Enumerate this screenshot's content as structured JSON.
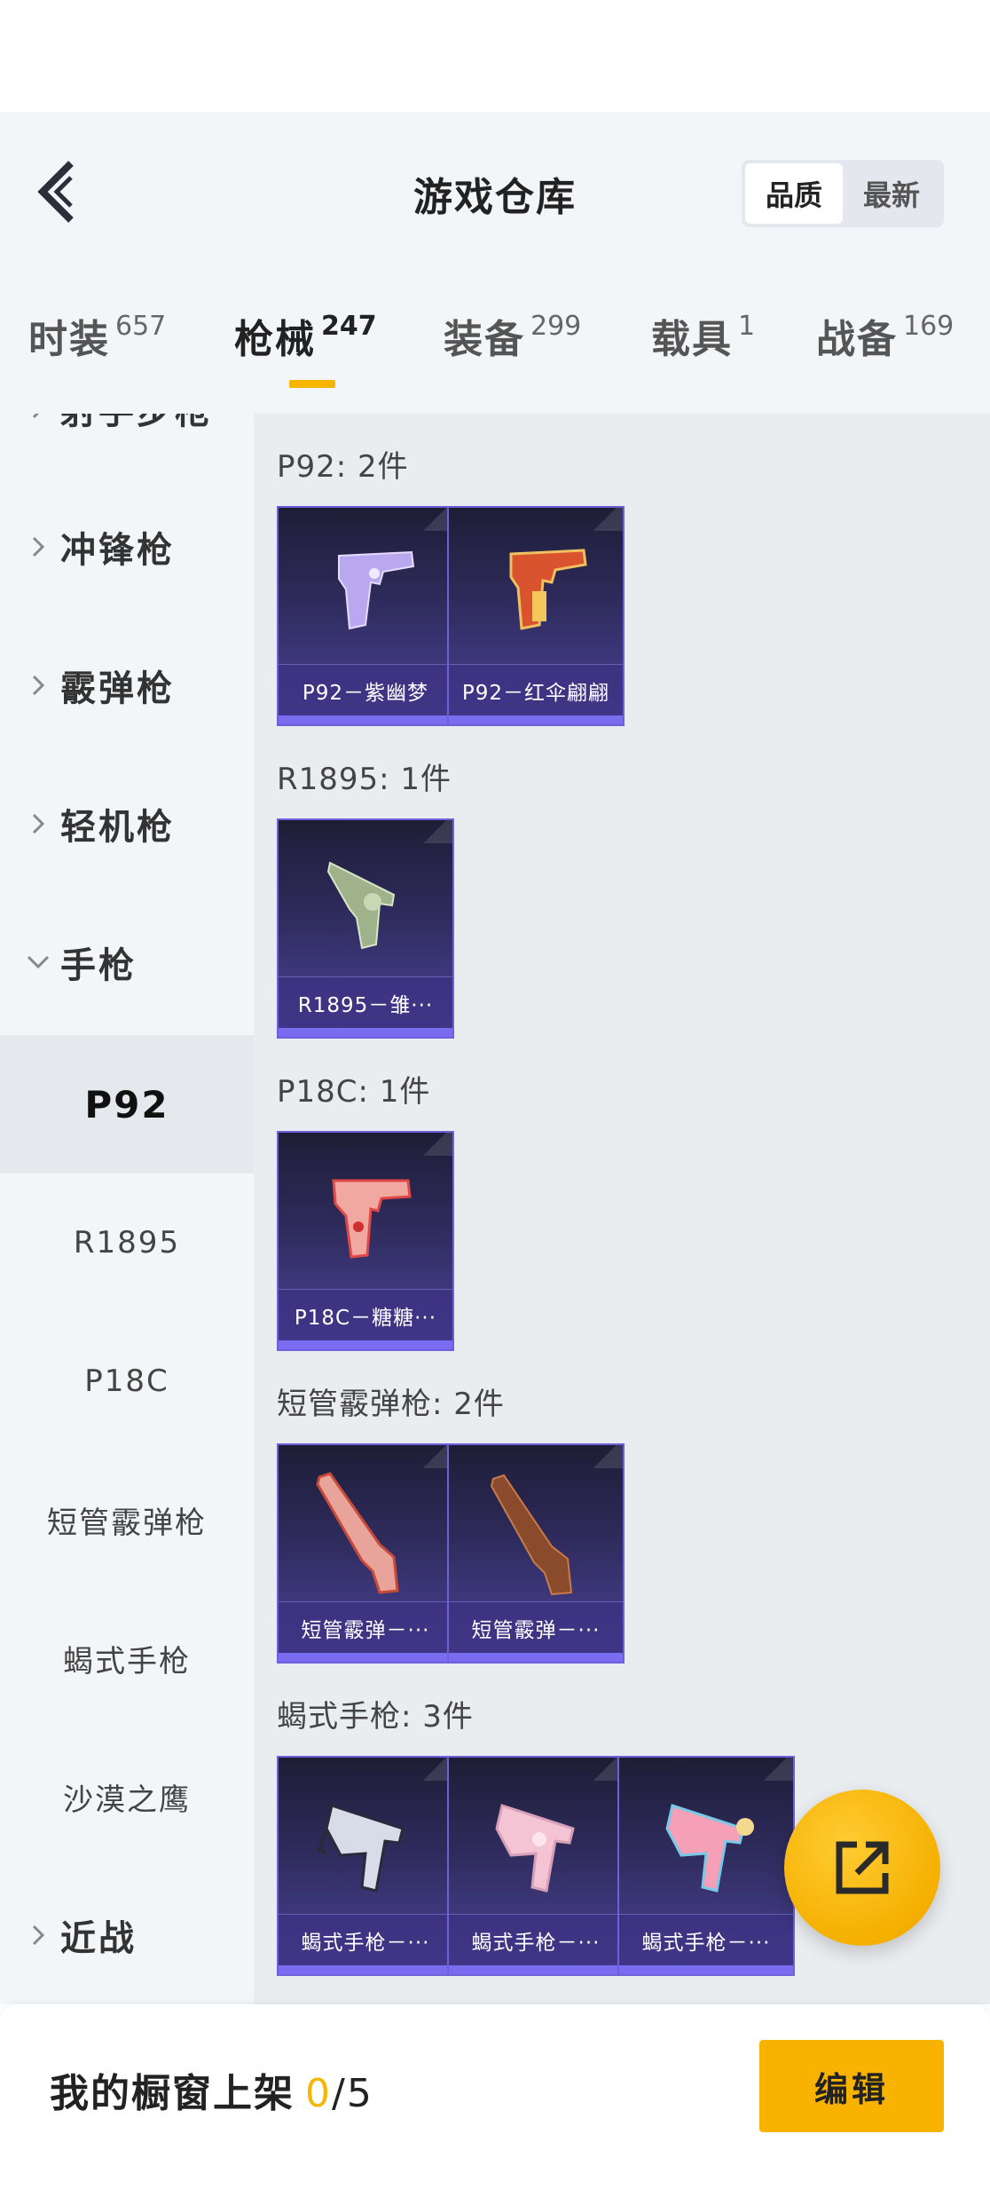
{
  "header": {
    "title": "游戏仓库",
    "sort_options": [
      "品质",
      "最新"
    ],
    "sort_selected": "品质"
  },
  "tabs": [
    {
      "label": "时装",
      "count": "657"
    },
    {
      "label": "枪械",
      "count": "247",
      "active": true
    },
    {
      "label": "装备",
      "count": "299"
    },
    {
      "label": "载具",
      "count": "1"
    },
    {
      "label": "战备",
      "count": "169"
    }
  ],
  "sidebar": {
    "categories": [
      {
        "label": "射手步枪",
        "expanded": false
      },
      {
        "label": "冲锋枪",
        "expanded": false
      },
      {
        "label": "霰弹枪",
        "expanded": false
      },
      {
        "label": "轻机枪",
        "expanded": false
      },
      {
        "label": "手枪",
        "expanded": true
      },
      {
        "label": "近战",
        "expanded": false
      }
    ],
    "pistol_subitems": [
      "P92",
      "R1895",
      "P18C",
      "短管霰弹枪",
      "蝎式手枪",
      "沙漠之鹰"
    ],
    "active_subitem": "P92"
  },
  "groups": [
    {
      "title": "P92: 2件",
      "items": [
        "P92－紫幽梦",
        "P92－红伞翩翩"
      ]
    },
    {
      "title": "R1895: 1件",
      "items": [
        "R1895－雏···"
      ]
    },
    {
      "title": "P18C: 1件",
      "items": [
        "P18C－糖糖···"
      ]
    },
    {
      "title": "短管霰弹枪: 2件",
      "items": [
        "短管霰弹－···",
        "短管霰弹－···"
      ]
    },
    {
      "title": "蝎式手枪: 3件",
      "items": [
        "蝎式手枪－···",
        "蝎式手枪－···",
        "蝎式手枪－···"
      ]
    }
  ],
  "bottom": {
    "showcase_label": "我的橱窗上架",
    "showcase_used": "0",
    "showcase_slash": "/",
    "showcase_total": "5",
    "edit_label": "编辑"
  },
  "colors": {
    "accent": "#f5b500",
    "card_border": "#6d60d8",
    "card_bg": "#2f2c5e"
  },
  "icons": [
    "back-chevron-icon",
    "chevron-right-icon",
    "chevron-down-icon",
    "share-export-icon"
  ]
}
